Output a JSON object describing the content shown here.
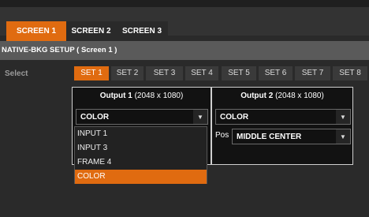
{
  "tabs": [
    {
      "label": "SCREEN 1",
      "active": true
    },
    {
      "label": "SCREEN 2",
      "active": false
    },
    {
      "label": "SCREEN 3",
      "active": false
    }
  ],
  "section_title": "NATIVE-BKG SETUP ( Screen 1 )",
  "select_label": "Select",
  "sets": [
    "SET 1",
    "SET 2",
    "SET 3",
    "SET 4",
    "SET 5",
    "SET 6",
    "SET 7",
    "SET 8"
  ],
  "active_set": "SET 1",
  "output1": {
    "title": "Output 1",
    "resolution": "(2048 x 1080)",
    "source_value": "COLOR",
    "source_options": [
      "INPUT 1",
      "INPUT 3",
      "FRAME 4",
      "COLOR"
    ],
    "selected_option": "COLOR"
  },
  "output2": {
    "title": "Output 2",
    "resolution": "(2048 x 1080)",
    "source_value": "COLOR",
    "pos_label": "Pos",
    "pos_value": "MIDDLE CENTER"
  },
  "colors": {
    "accent": "#e06b10",
    "tab_bar": "#333333",
    "section_header": "#5a5a5a",
    "background": "#2a2a2a"
  },
  "icons": {
    "dropdown_caret": "caret-down-icon"
  }
}
